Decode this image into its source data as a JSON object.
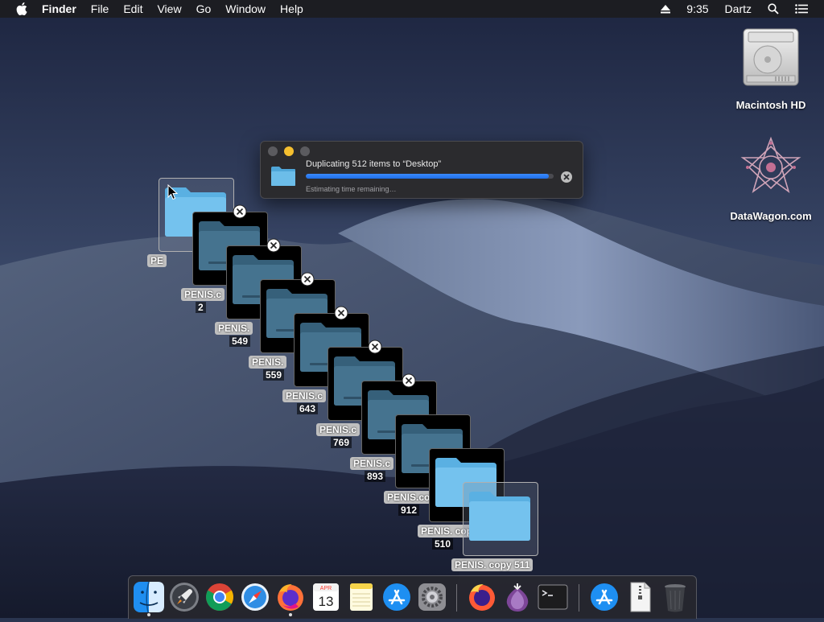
{
  "menubar": {
    "app_name": "Finder",
    "items": [
      "File",
      "Edit",
      "View",
      "Go",
      "Window",
      "Help"
    ],
    "clock": "9:35",
    "user": "Dartz"
  },
  "desktop_icons": {
    "hd_label": "Macintosh HD",
    "datawagon_label": "DataWagon.com"
  },
  "copy_dialog": {
    "title": "Duplicating 512 items to “Desktop”",
    "status": "Estimating time remaining…",
    "progress": 0.98
  },
  "folders": [
    {
      "name": "PE",
      "number": ""
    },
    {
      "name": "PENIS.c",
      "number": "2"
    },
    {
      "name": "PENIS.",
      "number": "549"
    },
    {
      "name": "PENIS.",
      "number": "559"
    },
    {
      "name": "PENIS.c",
      "number": "643"
    },
    {
      "name": "PENIS.c",
      "number": "769"
    },
    {
      "name": "PENIS.c",
      "number": "893"
    },
    {
      "name": "PENIS.copy",
      "number": "912"
    },
    {
      "name": "PENIS. copy 911",
      "number": "510"
    },
    {
      "name": "PENIS.   copy 511",
      "number": ""
    }
  ],
  "dock": {
    "apps": [
      "Finder",
      "Launchpad",
      "Google Chrome",
      "Safari",
      "Firefox",
      "Calendar",
      "Notes",
      "App Store",
      "System Preferences",
      "Firefox Nightly",
      "Tor Browser",
      "Terminal",
      "Downloads",
      "Archive",
      "Trash"
    ],
    "calendar_month": "APR",
    "calendar_day": "13"
  }
}
